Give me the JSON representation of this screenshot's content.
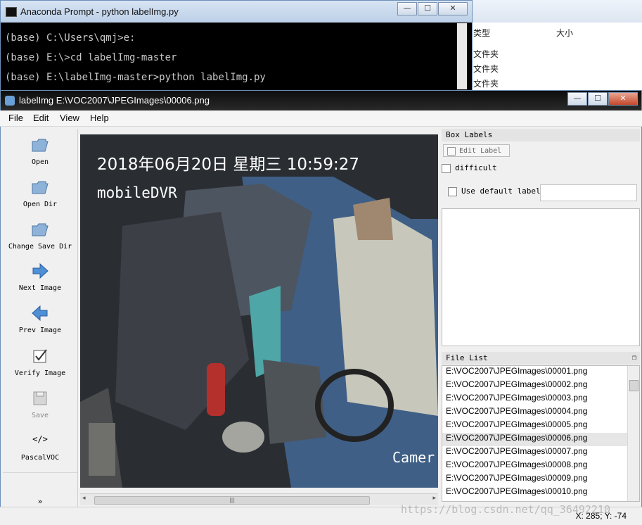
{
  "explorer": {
    "col_type": "类型",
    "col_size": "大小",
    "rows": [
      "文件夹",
      "文件夹",
      "文件夹"
    ]
  },
  "conda": {
    "title": "Anaconda Prompt - python  labelImg.py",
    "lines": [
      "(base) C:\\Users\\qmj>e:",
      "(base) E:\\>cd labelImg-master",
      "(base) E:\\labelImg-master>python labelImg.py"
    ]
  },
  "window": {
    "title": "labelImg E:\\VOC2007\\JPEGImages\\00006.png",
    "minimize": "—",
    "maximize": "☐",
    "close": "✕"
  },
  "menu": [
    "File",
    "Edit",
    "View",
    "Help"
  ],
  "toolbar": {
    "open": "Open",
    "open_dir": "Open Dir",
    "change_save_dir": "Change Save Dir",
    "next_image": "Next Image",
    "prev_image": "Prev Image",
    "verify_image": "Verify Image",
    "save": "Save",
    "format_glyph": "</>",
    "format": "PascalVOC",
    "more": "»"
  },
  "canvas": {
    "overlay_datetime": "2018年06月20日  星期三  10:59:27",
    "overlay_device": "mobileDVR",
    "overlay_corner": "Camer"
  },
  "box_labels": {
    "header": "Box Labels",
    "edit_label": "Edit Label",
    "difficult": "difficult",
    "use_default_label": "Use default label",
    "default_label_value": ""
  },
  "file_list": {
    "header": "File List",
    "items": [
      "E:\\VOC2007\\JPEGImages\\00001.png",
      "E:\\VOC2007\\JPEGImages\\00002.png",
      "E:\\VOC2007\\JPEGImages\\00003.png",
      "E:\\VOC2007\\JPEGImages\\00004.png",
      "E:\\VOC2007\\JPEGImages\\00005.png",
      "E:\\VOC2007\\JPEGImages\\00006.png",
      "E:\\VOC2007\\JPEGImages\\00007.png",
      "E:\\VOC2007\\JPEGImages\\00008.png",
      "E:\\VOC2007\\JPEGImages\\00009.png",
      "E:\\VOC2007\\JPEGImages\\00010.png"
    ],
    "selected_index": 5
  },
  "status": {
    "coords": "X: 285; Y: -74"
  },
  "watermark": "https://blog.csdn.net/qq_36492210"
}
